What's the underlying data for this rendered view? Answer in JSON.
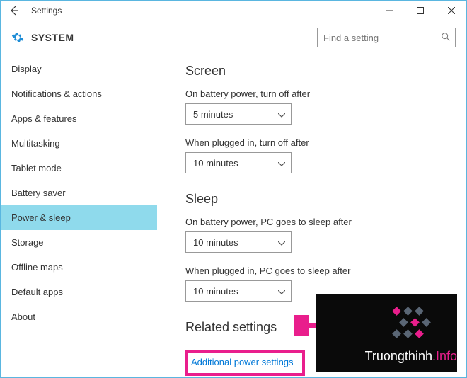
{
  "titlebar": {
    "title": "Settings"
  },
  "header": {
    "title": "SYSTEM",
    "search_placeholder": "Find a setting"
  },
  "sidebar": {
    "items": [
      {
        "label": "Display",
        "active": false
      },
      {
        "label": "Notifications & actions",
        "active": false
      },
      {
        "label": "Apps & features",
        "active": false
      },
      {
        "label": "Multitasking",
        "active": false
      },
      {
        "label": "Tablet mode",
        "active": false
      },
      {
        "label": "Battery saver",
        "active": false
      },
      {
        "label": "Power & sleep",
        "active": true
      },
      {
        "label": "Storage",
        "active": false
      },
      {
        "label": "Offline maps",
        "active": false
      },
      {
        "label": "Default apps",
        "active": false
      },
      {
        "label": "About",
        "active": false
      }
    ]
  },
  "content": {
    "screen": {
      "title": "Screen",
      "battery_label": "On battery power, turn off after",
      "battery_value": "5 minutes",
      "plugged_label": "When plugged in, turn off after",
      "plugged_value": "10 minutes"
    },
    "sleep": {
      "title": "Sleep",
      "battery_label": "On battery power, PC goes to sleep after",
      "battery_value": "10 minutes",
      "plugged_label": "When plugged in, PC goes to sleep after",
      "plugged_value": "10 minutes"
    },
    "related": {
      "title": "Related settings",
      "link": "Additional power settings"
    }
  },
  "watermark": {
    "text_main": "Truongthinh",
    "text_suffix": ".Info"
  }
}
